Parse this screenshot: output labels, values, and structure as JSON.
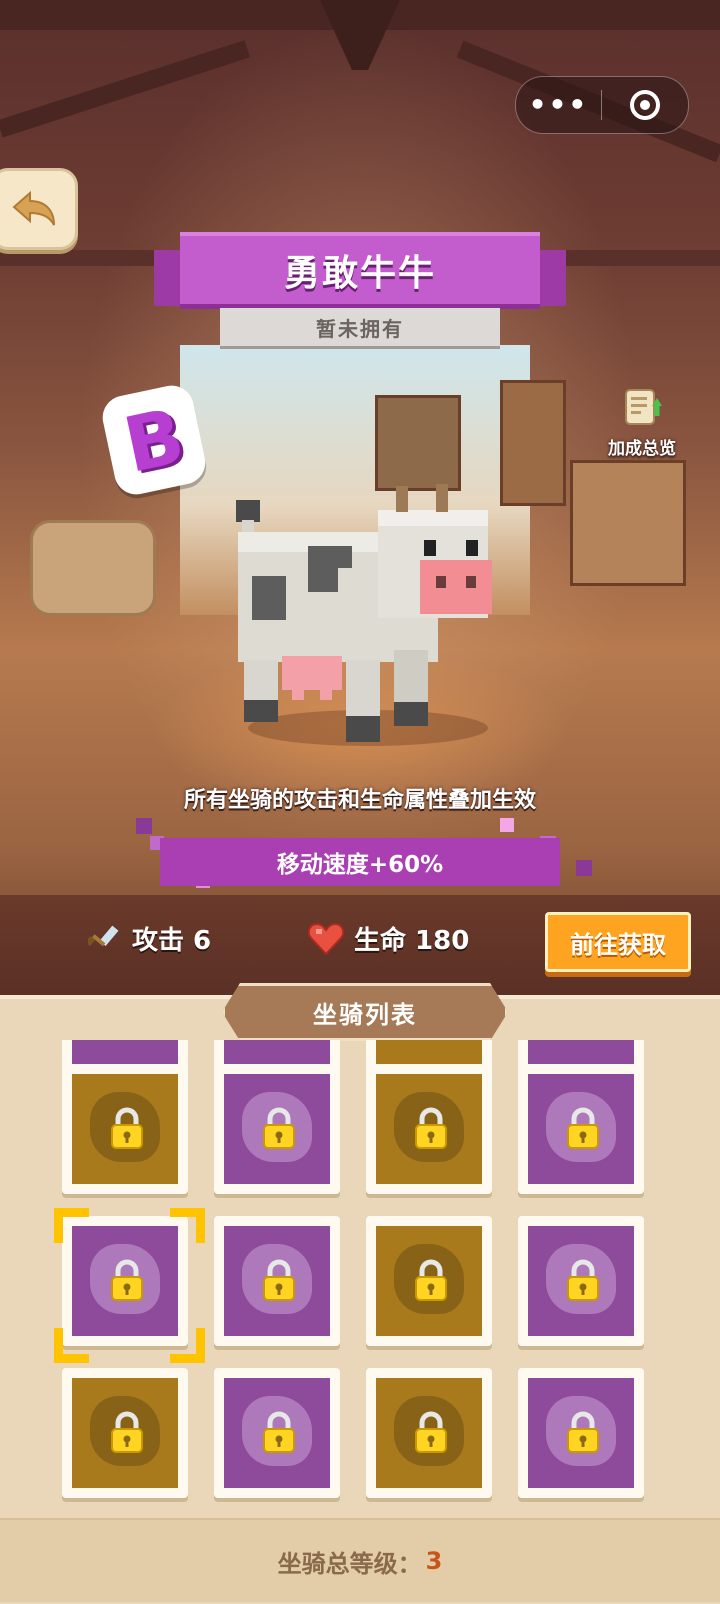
{
  "header": {
    "more_icon": "more-dots-icon",
    "close_icon": "target-circle-icon"
  },
  "mount": {
    "name": "勇敢牛牛",
    "status": "暂未拥有",
    "rank": "B",
    "bonus_overview_label": "加成总览",
    "description": "所有坐骑的攻击和生命属性叠加生效",
    "speed_bonus": "移动速度+60%",
    "attack_label": "攻击 6",
    "health_label": "生命 180",
    "goto_button": "前往获取"
  },
  "colors": {
    "rank_purple": "#b63ed0",
    "banner_purple": "#c35ccd",
    "button_orange": "#ffa421",
    "tile_gold": "#a87a1c",
    "tile_purple": "#8f4b9b",
    "level_accent": "#c8541a"
  },
  "mount_list": {
    "title": "坐骑列表",
    "rows": [
      [
        {
          "color": "gold",
          "locked": true
        },
        {
          "color": "purple",
          "locked": true
        },
        {
          "color": "gold",
          "locked": true
        },
        {
          "color": "purple",
          "locked": true
        }
      ],
      [
        {
          "color": "purple",
          "locked": true,
          "selected": true
        },
        {
          "color": "purple",
          "locked": true
        },
        {
          "color": "gold",
          "locked": true
        },
        {
          "color": "purple",
          "locked": true
        }
      ],
      [
        {
          "color": "gold",
          "locked": true
        },
        {
          "color": "purple",
          "locked": true
        },
        {
          "color": "gold",
          "locked": true
        },
        {
          "color": "purple",
          "locked": true
        }
      ]
    ]
  },
  "footer": {
    "level_label": "坐骑总等级：",
    "level_value": "3"
  }
}
